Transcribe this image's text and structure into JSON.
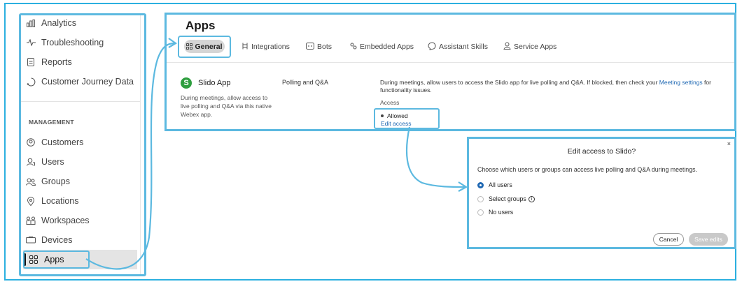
{
  "sidebar": {
    "items_top": [
      {
        "label": "Analytics",
        "icon": "bar-chart-icon"
      },
      {
        "label": "Troubleshooting",
        "icon": "pulse-icon"
      },
      {
        "label": "Reports",
        "icon": "document-icon"
      },
      {
        "label": "Customer Journey Data",
        "icon": "journey-icon"
      }
    ],
    "section_header": "MANAGEMENT",
    "items_management": [
      {
        "label": "Customers",
        "icon": "customers-icon"
      },
      {
        "label": "Users",
        "icon": "user-icon"
      },
      {
        "label": "Groups",
        "icon": "group-icon"
      },
      {
        "label": "Locations",
        "icon": "location-pin-icon"
      },
      {
        "label": "Workspaces",
        "icon": "workspaces-icon"
      },
      {
        "label": "Devices",
        "icon": "device-icon"
      },
      {
        "label": "Apps",
        "icon": "apps-grid-icon"
      }
    ]
  },
  "main": {
    "title": "Apps",
    "tabs": [
      {
        "label": "General",
        "icon": "apps-grid-icon",
        "active": true
      },
      {
        "label": "Integrations",
        "icon": "integrations-icon"
      },
      {
        "label": "Bots",
        "icon": "bot-icon"
      },
      {
        "label": "Embedded Apps",
        "icon": "embedded-apps-icon"
      },
      {
        "label": "Assistant Skills",
        "icon": "assistant-icon"
      },
      {
        "label": "Service Apps",
        "icon": "service-apps-icon"
      }
    ],
    "app": {
      "logo_letter": "S",
      "name": "Slido App",
      "description": "During meetings, allow access to live polling and Q&A via this native Webex app.",
      "type": "Polling and Q&A",
      "info_prefix": "During meetings, allow users to access the Slido app for live polling and Q&A. If blocked, then check your ",
      "info_link": "Meeting settings",
      "info_suffix": " for functionality issues.",
      "access_label": "Access",
      "access_status": "Allowed",
      "edit_access": "Edit access"
    }
  },
  "dialog": {
    "title": "Edit access to Slido?",
    "close": "×",
    "description": "Choose which users or groups can access live polling and Q&A during meetings.",
    "options": [
      {
        "label": "All users",
        "selected": true
      },
      {
        "label": "Select groups",
        "selected": false,
        "info": "i"
      },
      {
        "label": "No users",
        "selected": false
      }
    ],
    "cancel": "Cancel",
    "save": "Save edits"
  },
  "colors": {
    "highlight": "#5cb9e0",
    "link": "#1f68b3",
    "slido_green": "#2e9e3f"
  }
}
